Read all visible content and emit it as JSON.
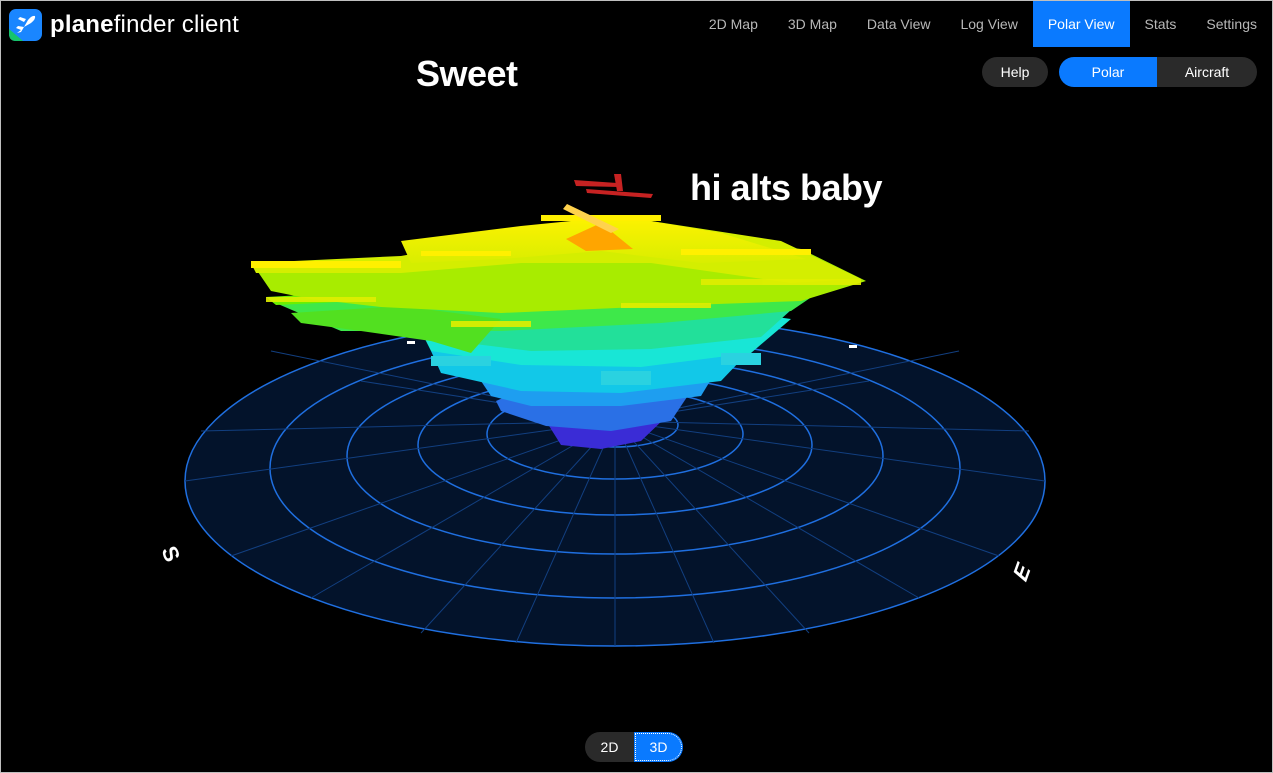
{
  "app": {
    "logo_icon": "plane-logo-icon",
    "name_bold": "plane",
    "name_rest": "finder client"
  },
  "nav": [
    {
      "label": "2D Map",
      "active": false
    },
    {
      "label": "3D Map",
      "active": false
    },
    {
      "label": "Data View",
      "active": false
    },
    {
      "label": "Log View",
      "active": false
    },
    {
      "label": "Polar View",
      "active": true
    },
    {
      "label": "Stats",
      "active": false
    },
    {
      "label": "Settings",
      "active": false
    }
  ],
  "headline": "Sweet",
  "annotation": "hi alts baby",
  "controls": {
    "help": "Help",
    "polar": "Polar",
    "aircraft": "Aircraft",
    "selected": "Polar"
  },
  "compass": {
    "south": "S",
    "east": "E"
  },
  "view_toggle": {
    "option_2d": "2D",
    "option_3d": "3D",
    "selected": "3D"
  },
  "colors": {
    "accent": "#0a7aff",
    "grid_line": "#1f6fe0",
    "grid_fill": "#03132b",
    "low_alt": "#3a2cd6",
    "mid_alt": "#16e6e6",
    "upper_alt": "#7ff000",
    "high_alt": "#fff000",
    "peak_alt": "#ffa500",
    "top_alt": "#cc2222"
  }
}
